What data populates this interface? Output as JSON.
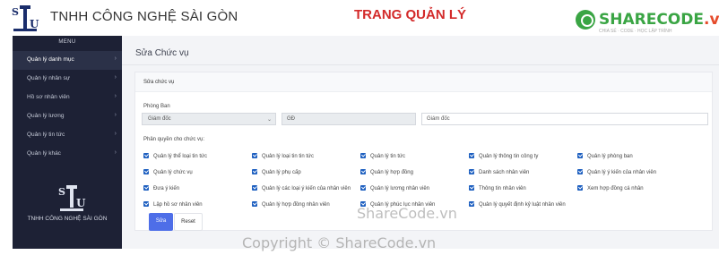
{
  "header": {
    "company": "TNHH CÔNG NGHỆ SÀI GÒN",
    "page_heading": "TRANG QUẢN LÝ",
    "watermark_part1": "SHARECODE",
    "watermark_part2": ".vn",
    "watermark_sub": "CHIA SẺ · CODE · HỌC LẬP TRÌNH"
  },
  "sidebar": {
    "menu_title": "MENU",
    "items": [
      {
        "label": "Quản lý danh mục",
        "active": true
      },
      {
        "label": "Quản lý nhân sự"
      },
      {
        "label": "Hồ sơ nhân viên"
      },
      {
        "label": "Quản lý lương"
      },
      {
        "label": "Quản lý tin tức"
      },
      {
        "label": "Quản lý khác"
      }
    ],
    "chevron": "›",
    "footer_company": "TNHH CÔNG NGHỆ SÀI GÒN"
  },
  "main": {
    "title": "Sửa Chức vụ",
    "card_label": "Sửa chức vụ",
    "department_label": "Phòng Ban",
    "department_value": "Giám đốc",
    "code_value": "GĐ",
    "name_value": "Giám đốc",
    "permissions_label": "Phân quyền cho chức vụ:",
    "permissions": [
      [
        "Quản lý thể loại tin tức",
        "Quản lý loại tin tin tức",
        "Quản lý tin tức",
        "Quản lý thông tin công ty",
        "Quản lý phòng ban"
      ],
      [
        "Quản lý chức vụ",
        "Quản lý phụ cấp",
        "Quản lý hợp đồng",
        "Danh sách nhân viên",
        "Quản lý ý kiến của nhân viên"
      ],
      [
        "Đưa ý kiến",
        "Quản lý các loại ý kiến của nhân viên",
        "Quản lý lương nhân viên",
        "Thông tin nhân viên",
        "Xem hợp đồng cá nhân"
      ],
      [
        "Lập hồ sơ nhân viên",
        "Quản lý hợp đồng nhân viên",
        "Quản lý phúc lục nhân viên",
        "Quản lý quyết định kỷ luật nhân viên"
      ]
    ],
    "save_label": "Sửa",
    "reset_label": "Reset"
  },
  "watermarks": {
    "middle": "ShareCode.vn",
    "footer": "Copyright © ShareCode.vn"
  },
  "colors": {
    "sidebar_bg": "#1d2135",
    "heading_red": "#d32a2a",
    "primary_button": "#4e6ee8",
    "checkbox": "#1d5fc0"
  }
}
